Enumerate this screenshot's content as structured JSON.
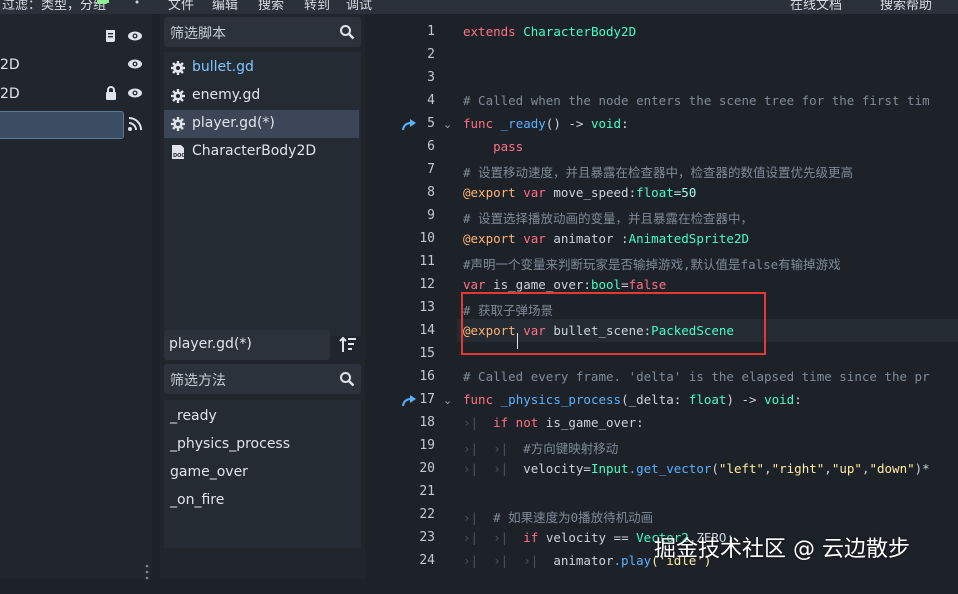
{
  "topbar": {
    "search_placeholder": "过滤：类型，分组",
    "menus": [
      "文件",
      "编辑",
      "搜索",
      "转到",
      "调试"
    ],
    "right_items": [
      "在线文档",
      "搜索帮助"
    ]
  },
  "scene_tree": {
    "rows": [
      {
        "label": ""
      },
      {
        "label": "2D"
      },
      {
        "label": "2D"
      },
      {
        "label": ""
      }
    ]
  },
  "scripts_panel": {
    "filter_placeholder": "筛选脚本",
    "items": [
      {
        "label": "bullet.gd",
        "icon": "gear-icon"
      },
      {
        "label": "enemy.gd",
        "icon": "gear-icon"
      },
      {
        "label": "player.gd(*)",
        "icon": "gear-icon"
      },
      {
        "label": "CharacterBody2D",
        "icon": "doc-icon"
      }
    ],
    "current_file": "player.gd(*)",
    "methods_filter_placeholder": "筛选方法",
    "methods": [
      "_ready",
      "_physics_process",
      "game_over",
      "_on_fire"
    ]
  },
  "editor": {
    "line_numbers": [
      "1",
      "2",
      "3",
      "4",
      "5",
      "6",
      "7",
      "8",
      "9",
      "10",
      "11",
      "12",
      "13",
      "14",
      "15",
      "16",
      "17",
      "18",
      "19",
      "20",
      "21",
      "22",
      "23",
      "24"
    ],
    "lines": {
      "l1_kw": "extends",
      "l1_type": "CharacterBody2D",
      "l4": "# Called when the node enters the scene tree for the first tim",
      "l5_kw": "func",
      "l5_fn": "_ready",
      "l5_rest": "() ->",
      "l5_type": "void",
      "l6": "pass",
      "l7": "# 设置移动速度，并且暴露在检查器中，检查器的数值设置优先级更高",
      "l8_ann": "@export",
      "l8_kw": "var",
      "l8_name": "move_speed:",
      "l8_type": "float",
      "l8_val": "=50",
      "l9": "# 设置选择播放动画的变量，并且暴露在检查器中，",
      "l10_ann": "@export",
      "l10_kw": "var",
      "l10_name": "animator :",
      "l10_type": "AnimatedSprite2D",
      "l11": "#声明一个变量来判断玩家是否输掉游戏,默认值是false有输掉游戏",
      "l12_kw": "var",
      "l12_name": "is_game_over:",
      "l12_type": "bool",
      "l12_eq": "=",
      "l12_val": "false",
      "l13": "# 获取子弹场景",
      "l14_ann": "@export",
      "l14_kw": "var",
      "l14_name": "bullet_scene:",
      "l14_type": "PackedScene",
      "l16": "# Called every frame. 'delta' is the elapsed time since the pr",
      "l17_kw": "func",
      "l17_fn": "_physics_process",
      "l17_args": "(_delta:",
      "l17_type": "float",
      "l17_rest": ") ->",
      "l17_type2": "void",
      "l18_kw": "if not",
      "l18_rest": "is_game_over:",
      "l19": "#方向键映射移动",
      "l20_a": "velocity=",
      "l20_obj": "Input",
      "l20_fn": ".get_vector",
      "l20_args": "(",
      "l20_s1": "\"left\"",
      "l20_s2": "\"right\"",
      "l20_s3": "\"up\"",
      "l20_s4": "\"down\"",
      "l20_end": ")*",
      "l22": "# 如果速度为0播放待机动画",
      "l23_kw": "if",
      "l23_rest": "velocity ==",
      "l23_obj": "Vector2",
      "l23_end": ".ZERO:",
      "l24_a": "animator",
      "l24_fn": ".play",
      "l24_s": "('idle')"
    }
  },
  "watermark": "掘金技术社区 @ 云边散步",
  "colors": {
    "keyword": "#ff7085",
    "type": "#42ffc2",
    "function": "#57b3ff",
    "comment": "#7f8b98",
    "string": "#ffeda1",
    "annotation_box": "#e53935"
  }
}
